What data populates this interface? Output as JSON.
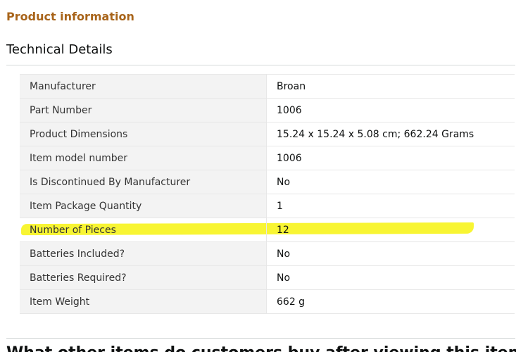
{
  "section": {
    "title": "Product information",
    "subtitle": "Technical Details"
  },
  "highlight_color": "#f6f300",
  "technical_details": [
    {
      "label": "Manufacturer",
      "value": "Broan"
    },
    {
      "label": "Part Number",
      "value": "1006"
    },
    {
      "label": "Product Dimensions",
      "value": "15.24 x 15.24 x 5.08 cm; 662.24 Grams"
    },
    {
      "label": "Item model number",
      "value": "1006"
    },
    {
      "label": "Is Discontinued By Manufacturer",
      "value": "No"
    },
    {
      "label": "Item Package Quantity",
      "value": "1"
    },
    {
      "label": "Number of Pieces",
      "value": "12"
    },
    {
      "label": "Batteries Included?",
      "value": "No"
    },
    {
      "label": "Batteries Required?",
      "value": "No"
    },
    {
      "label": "Item Weight",
      "value": "662 g"
    }
  ],
  "next_heading": "What other items do customers buy after viewing this item?"
}
